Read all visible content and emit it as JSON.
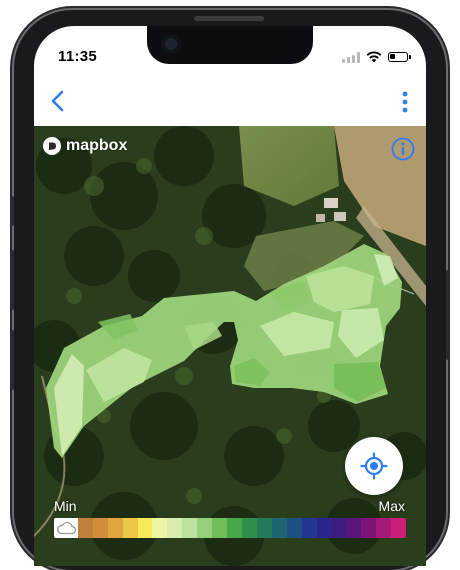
{
  "status_bar": {
    "time": "11:35"
  },
  "map": {
    "logo_text": "mapbox",
    "legend": {
      "min_label": "Min",
      "max_label": "Max",
      "colors": [
        "#c2813a",
        "#d18e3a",
        "#dfa43e",
        "#ecc84a",
        "#f6ea58",
        "#eef3a8",
        "#d9ecb0",
        "#bee2a0",
        "#97d07a",
        "#6fbe5c",
        "#47a84a",
        "#2f8f49",
        "#237a59",
        "#1d6570",
        "#1e4f82",
        "#22388f",
        "#2b278a",
        "#3c1d80",
        "#5a167b",
        "#7e1477",
        "#a51a78",
        "#c91f7a"
      ]
    }
  },
  "icons": {
    "back": "chevron-left-icon",
    "more": "more-vertical-icon",
    "info": "info-icon",
    "locate": "locate-crosshair-icon",
    "cloud": "cloud-icon",
    "accent": "#2f7cf6"
  }
}
